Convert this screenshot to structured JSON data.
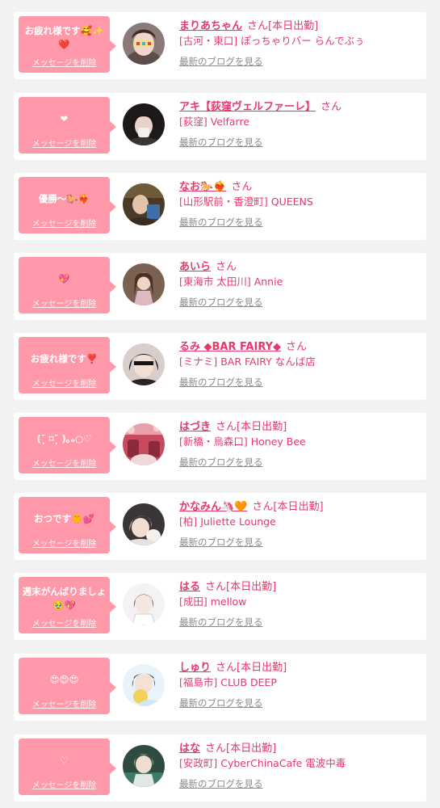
{
  "common": {
    "delete_label": "メッセージを削除",
    "blog_link": "最新のブログを見る",
    "honorific": "さん"
  },
  "items": [
    {
      "message": "お疲れ様です🥰✨❤️",
      "name": "まりあちゃん",
      "status": "[本日出勤]",
      "shop": "[古河・東口] ぽっちゃりバー らんでぶぅ"
    },
    {
      "message": "❤︎",
      "name": "アキ【荻窪ヴェルファーレ】",
      "status": "",
      "shop": "[荻窪] Velfarre"
    },
    {
      "message": "優勝〜🐎❤️‍🔥",
      "name": "なお🐎❤️‍🔥",
      "status": "",
      "shop": "[山形駅前・香澄町] QUEENS"
    },
    {
      "message": "💖",
      "name": "あいら",
      "status": "",
      "shop": "[東海市 太田川] Annie"
    },
    {
      "message": "お疲れ様です❣️",
      "name": "るみ ◆BAR FAIRY◆",
      "status": "",
      "shop": "[ミナミ] BAR FAIRY なんば店"
    },
    {
      "message": "(˘̩̩̩ ⌑˘̩̩̩ )｡ₒ○♡",
      "name": "はづき",
      "status": "[本日出勤]",
      "shop": "[新橋・烏森口] Honey Bee"
    },
    {
      "message": "おつです🐥💕",
      "name": "かなみん🦄🧡",
      "status": "[本日出勤]",
      "shop": "[柏] Juliette Lounge"
    },
    {
      "message": "週末がんばりましょ🥹💖",
      "name": "はる",
      "status": "[本日出勤]",
      "shop": "[成田] mellow"
    },
    {
      "message": "😍😍😍",
      "name": "しゅり",
      "status": "[本日出勤]",
      "shop": "[福島市] CLUB DEEP"
    },
    {
      "message": "♡",
      "name": "はな",
      "status": "[本日出勤]",
      "shop": "[安政町] CyberChinaCafe 電波中毒"
    }
  ]
}
